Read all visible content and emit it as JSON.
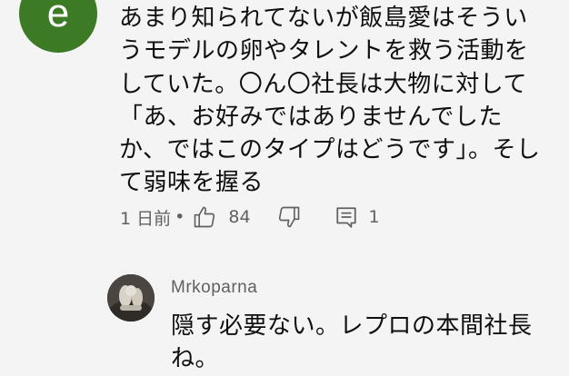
{
  "comment": {
    "avatar_letter": "e",
    "avatar_color": "#3d7a26",
    "text": "あまり知られてないが飯島愛はそういうモデルの卵やタレントを救う活動をしていた。〇ん〇社長は大物に対して「あ、お好みではありませんでしたか、ではこのタイプはどうです」。そして弱味を握る",
    "time": "1 日前",
    "separator": "•",
    "like_count": "84",
    "reply_count": "1",
    "icons": [
      "thumbs-up-icon",
      "thumbs-down-icon",
      "reply-icon"
    ]
  },
  "reply": {
    "author": "Mrkoparna",
    "text": "隠す必要ない。レプロの本間社長ね。"
  }
}
